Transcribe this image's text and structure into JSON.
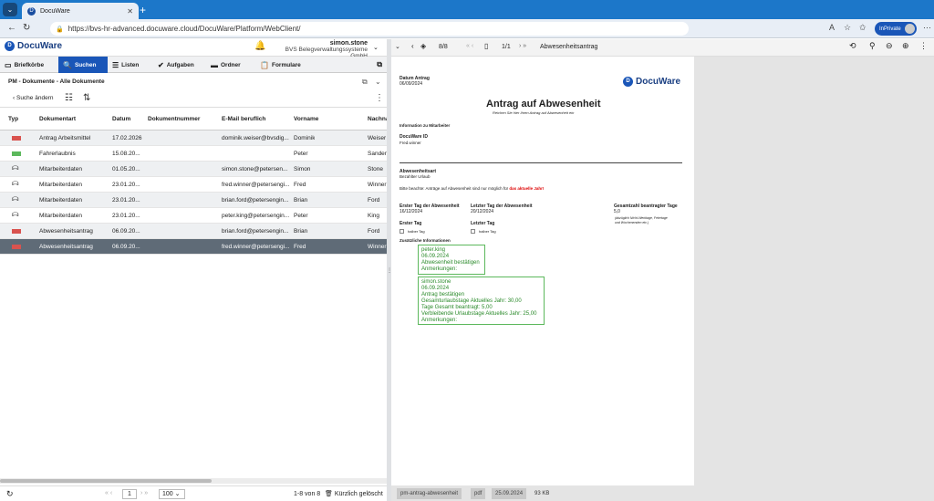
{
  "browser": {
    "tab_title": "DocuWare",
    "url": "https://bvs-hr-advanced.docuware.cloud/DocuWare/Platform/WebClient/",
    "inprivate_label": "InPrivate"
  },
  "app": {
    "logo": "DocuWare",
    "user_name": "simon.stone",
    "user_org": "BVS Belegverwaltungssysteme GmbH",
    "menu": [
      {
        "label": "Briefkörbe",
        "icon": "inbox-icon"
      },
      {
        "label": "Suchen",
        "icon": "search-icon"
      },
      {
        "label": "Listen",
        "icon": "list-icon"
      },
      {
        "label": "Aufgaben",
        "icon": "check-icon"
      },
      {
        "label": "Ordner",
        "icon": "folder-icon"
      },
      {
        "label": "Formulare",
        "icon": "form-icon"
      }
    ],
    "panel_title": "PM - Dokumente - Alle Dokumente",
    "back_label": "Suche ändern"
  },
  "grid": {
    "columns": [
      "Typ",
      "Dokumentart",
      "Datum",
      "Dokumentnummer",
      "E-Mail beruflich",
      "Vorname",
      "Nachna"
    ],
    "rows": [
      {
        "type": "pdf",
        "doc": "Antrag Arbeitsmittel",
        "date": "17.02.2026",
        "num": "",
        "email": "dominik.weiser@bvsdig...",
        "first": "Dominik",
        "last": "Weiser"
      },
      {
        "type": "img",
        "doc": "Fahrerlaubnis",
        "date": "15.08.20...",
        "num": "",
        "email": "",
        "first": "Peter",
        "last": "Sander"
      },
      {
        "type": "db",
        "doc": "Mitarbeiterdaten",
        "date": "01.05.20...",
        "num": "",
        "email": "simon.stone@petersen...",
        "first": "Simon",
        "last": "Stone"
      },
      {
        "type": "db",
        "doc": "Mitarbeiterdaten",
        "date": "23.01.20...",
        "num": "",
        "email": "fred.winner@petersengi...",
        "first": "Fred",
        "last": "Winner"
      },
      {
        "type": "db",
        "doc": "Mitarbeiterdaten",
        "date": "23.01.20...",
        "num": "",
        "email": "brian.ford@petersengin...",
        "first": "Brian",
        "last": "Ford"
      },
      {
        "type": "db",
        "doc": "Mitarbeiterdaten",
        "date": "23.01.20...",
        "num": "",
        "email": "peter.king@petersengin...",
        "first": "Peter",
        "last": "King"
      },
      {
        "type": "pdf",
        "doc": "Abwesenheitsantrag",
        "date": "06.09.20...",
        "num": "",
        "email": "brian.ford@petersengin...",
        "first": "Brian",
        "last": "Ford"
      },
      {
        "type": "pdf",
        "doc": "Abwesenheitsantrag",
        "date": "06.09.20...",
        "num": "",
        "email": "fred.winner@petersengi...",
        "first": "Fred",
        "last": "Winner"
      }
    ]
  },
  "pager": {
    "page": "1",
    "page_size": "100",
    "range": "1-8 von 8",
    "deleted_label": "Kürzlich gelöscht"
  },
  "viewer": {
    "pages": "8/8",
    "page_of": "1/1",
    "doc_title": "Abwesenheitsantrag",
    "status": [
      "pm-antrag-abwesenheit",
      "pdf",
      "25.09.2024",
      "93 KB"
    ]
  },
  "document": {
    "date_label": "Datum Antrag",
    "date_value": "06/09/2024",
    "logo": "DocuWare",
    "title": "Antrag auf Abwesenheit",
    "subtitle": "Reichen Sie hier Ihren Antrag auf Abwesenheit ein",
    "info_label": "Information zu Mitarbeiter",
    "id_label": "DocuWare ID",
    "id_value": "Fred.winner",
    "type_label": "Abwesenheitsart",
    "type_value": "Bezahlter Urlaub",
    "note": "Bitte beachte: Anträge auf Abwesenheit sind nur möglich für",
    "note_red": "das aktuelle Jahr!",
    "first_label": "Erster Tag der Abwesenheit",
    "first_value": "16/12/2024",
    "last_label": "Letzter Tag der Abwesenheit",
    "last_value": "20/12/2024",
    "total_label": "Gesamtzahl beantragter Tage",
    "total_value": "5,0",
    "total_hint1": "(abzüglich Nicht-Werktage, Feiertage",
    "total_hint2": "und Wochenenden etc.)",
    "ft_label": "Erster Tag",
    "lt_label": "Letzter Tag",
    "half_label": "halber Tag",
    "extra_label": "Zusätzliche Informationen",
    "stamp1": [
      "peter.king",
      "06.09.2024",
      "Abwesenheit bestätigen",
      "Anmerkungen:"
    ],
    "stamp2": [
      "simon.stone",
      "06.09.2024",
      "Antrag bestätigen",
      "Gesamturlaubstage Aktuelles Jahr: 30,00",
      "Tage Gesamt beantragt: 5,00",
      "Verbleibende Urlaubstage Aktuelles Jahr: 25,00",
      "Anmerkungen:"
    ]
  }
}
